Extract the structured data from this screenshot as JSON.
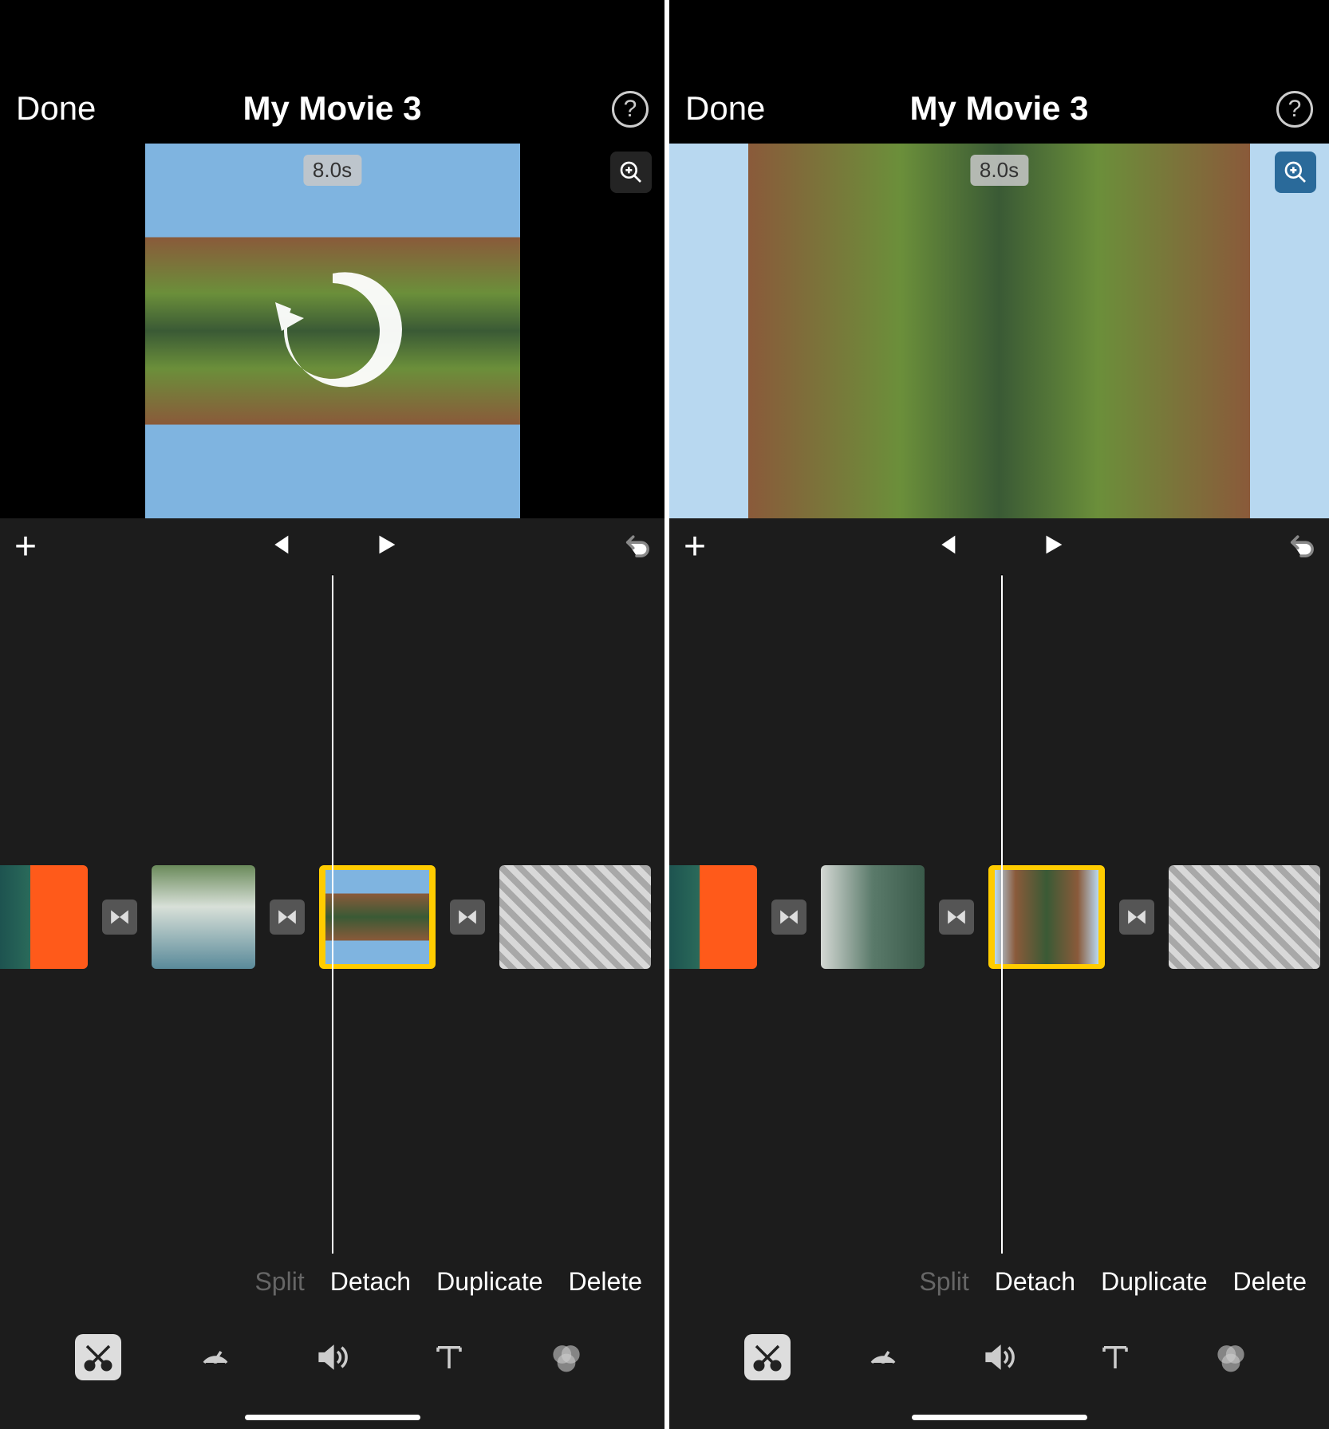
{
  "left": {
    "header": {
      "done": "Done",
      "title": "My Movie 3"
    },
    "duration": "8.0s",
    "actions": {
      "split": "Split",
      "detach": "Detach",
      "duplicate": "Duplicate",
      "delete": "Delete"
    },
    "clips": [
      "orange-pour",
      "waterfall",
      "mountain-lake",
      "rapids"
    ],
    "selected_clip_index": 2,
    "zoom_active": false,
    "show_rotate_overlay": true
  },
  "right": {
    "header": {
      "done": "Done",
      "title": "My Movie 3"
    },
    "duration": "8.0s",
    "actions": {
      "split": "Split",
      "detach": "Detach",
      "duplicate": "Duplicate",
      "delete": "Delete"
    },
    "clips": [
      "orange-pour",
      "waterfall-rotated",
      "mountain-lake-rotated",
      "rapids"
    ],
    "selected_clip_index": 2,
    "zoom_active": true,
    "show_rotate_overlay": false
  },
  "tools": [
    "cut",
    "speed",
    "volume",
    "text",
    "filters"
  ],
  "active_tool": "cut"
}
